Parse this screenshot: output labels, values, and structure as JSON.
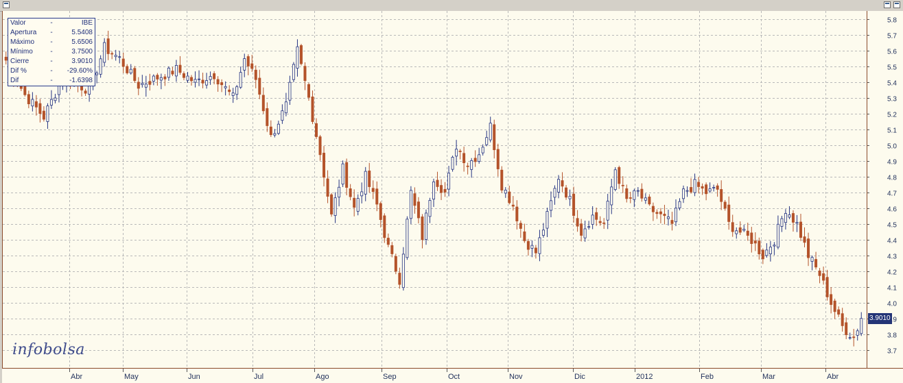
{
  "window": {
    "icon": "window-icon"
  },
  "info_box": {
    "rows": [
      {
        "label": "Valor",
        "sep": "-",
        "value": "IBE"
      },
      {
        "label": "Apertura",
        "sep": "-",
        "value": "5.5408"
      },
      {
        "label": "Máximo",
        "sep": "-",
        "value": "5.6506"
      },
      {
        "label": "Mínimo",
        "sep": "-",
        "value": "3.7500"
      },
      {
        "label": "Cierre",
        "sep": "-",
        "value": "3.9010"
      },
      {
        "label": "Dif %",
        "sep": "-",
        "value": "-29.60%"
      },
      {
        "label": "Dif",
        "sep": "-",
        "value": "-1.6398"
      }
    ]
  },
  "logo": {
    "text": "infobolsa"
  },
  "last_price_label": "3.9010",
  "colors": {
    "background": "#fdfbee",
    "up": "#243382",
    "down": "#b4532a",
    "grid": "#b8b8b8"
  },
  "chart_data": {
    "type": "candlestick",
    "ylim": [
      3.65,
      5.85
    ],
    "y_ticks": [
      "3.7",
      "3.8",
      "3.9",
      "4.0",
      "4.1",
      "4.2",
      "4.3",
      "4.4",
      "4.5",
      "4.6",
      "4.7",
      "4.8",
      "4.9",
      "5.0",
      "5.1",
      "5.2",
      "5.3",
      "5.4",
      "5.5",
      "5.6",
      "5.7",
      "5.8"
    ],
    "x_labels": [
      "Abr",
      "May",
      "Jun",
      "Jul",
      "Ago",
      "Sep",
      "Oct",
      "Nov",
      "Dic",
      "2012",
      "Feb",
      "Mar",
      "Abr"
    ],
    "grid": true,
    "last_close": 3.901,
    "waypoints": [
      [
        0,
        5.54
      ],
      [
        5,
        5.32
      ],
      [
        10,
        5.18
      ],
      [
        15,
        5.43
      ],
      [
        22,
        5.35
      ],
      [
        26,
        5.62
      ],
      [
        30,
        5.55
      ],
      [
        35,
        5.38
      ],
      [
        40,
        5.43
      ],
      [
        45,
        5.48
      ],
      [
        50,
        5.4
      ],
      [
        55,
        5.45
      ],
      [
        60,
        5.3
      ],
      [
        63,
        5.55
      ],
      [
        66,
        5.42
      ],
      [
        70,
        5.05
      ],
      [
        74,
        5.25
      ],
      [
        77,
        5.6
      ],
      [
        80,
        5.3
      ],
      [
        83,
        4.95
      ],
      [
        86,
        4.55
      ],
      [
        89,
        4.85
      ],
      [
        92,
        4.6
      ],
      [
        95,
        4.8
      ],
      [
        98,
        4.62
      ],
      [
        101,
        4.35
      ],
      [
        104,
        4.15
      ],
      [
        107,
        4.7
      ],
      [
        110,
        4.42
      ],
      [
        113,
        4.8
      ],
      [
        116,
        4.7
      ],
      [
        119,
        5.0
      ],
      [
        122,
        4.88
      ],
      [
        125,
        4.95
      ],
      [
        128,
        5.12
      ],
      [
        131,
        4.75
      ],
      [
        134,
        4.62
      ],
      [
        137,
        4.4
      ],
      [
        140,
        4.32
      ],
      [
        143,
        4.55
      ],
      [
        146,
        4.8
      ],
      [
        149,
        4.65
      ],
      [
        152,
        4.45
      ],
      [
        155,
        4.55
      ],
      [
        158,
        4.5
      ],
      [
        161,
        4.85
      ],
      [
        164,
        4.65
      ],
      [
        167,
        4.7
      ],
      [
        170,
        4.6
      ],
      [
        173,
        4.55
      ],
      [
        176,
        4.5
      ],
      [
        179,
        4.7
      ],
      [
        182,
        4.75
      ],
      [
        185,
        4.7
      ],
      [
        188,
        4.72
      ],
      [
        191,
        4.5
      ],
      [
        194,
        4.45
      ],
      [
        197,
        4.4
      ],
      [
        200,
        4.3
      ],
      [
        203,
        4.4
      ],
      [
        206,
        4.6
      ],
      [
        209,
        4.5
      ],
      [
        212,
        4.3
      ],
      [
        215,
        4.18
      ],
      [
        218,
        4.0
      ],
      [
        221,
        3.85
      ],
      [
        224,
        3.78
      ],
      [
        226,
        3.9
      ]
    ]
  }
}
